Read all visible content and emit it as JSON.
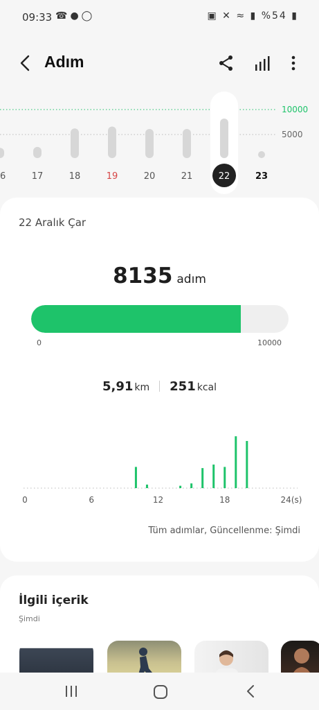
{
  "status_bar": {
    "time": "09:33",
    "left_icons": [
      "whatsapp-icon",
      "notification-icon",
      "shazam-icon"
    ],
    "right_icons": [
      "battery-saver-icon",
      "mute-icon",
      "wifi-icon",
      "signal-icon",
      "battery-icon"
    ],
    "battery": "%54"
  },
  "app_bar": {
    "title": "Adım",
    "actions": [
      "share-icon",
      "bar-chart-icon",
      "more-vertical-icon"
    ]
  },
  "week_chart": {
    "goal_label": "10000",
    "mid_label": "5000",
    "days": [
      {
        "label": "16",
        "steps": 2100,
        "status": "normal"
      },
      {
        "label": "17",
        "steps": 2300,
        "status": "normal"
      },
      {
        "label": "18",
        "steps": 6100,
        "status": "normal"
      },
      {
        "label": "19",
        "steps": 6500,
        "status": "sunday"
      },
      {
        "label": "20",
        "steps": 6000,
        "status": "normal"
      },
      {
        "label": "21",
        "steps": 6000,
        "status": "normal"
      },
      {
        "label": "22",
        "steps": 8135,
        "status": "selected"
      },
      {
        "label": "23",
        "steps": 0,
        "status": "future"
      }
    ],
    "max": 10000,
    "colors": {
      "bar": "#d7d7d7",
      "goal_line": "#1ec36a",
      "sunday": "#d64545",
      "selected_bg": "#222222"
    }
  },
  "day_summary": {
    "date": "22 Aralık Çar",
    "steps": "8135",
    "steps_unit": "adım",
    "progress": {
      "value": 8135,
      "goal": 10000,
      "min_label": "0",
      "max_label": "10000"
    },
    "distance": "5,91",
    "distance_unit": "km",
    "calories": "251",
    "calories_unit": "kcal",
    "accent_color": "#1ec36a"
  },
  "chart_data": {
    "type": "bar",
    "x_tick_labels": [
      "0",
      "6",
      "12",
      "18",
      "24(s)"
    ],
    "x": [
      10,
      11,
      14,
      15,
      16,
      17,
      18,
      19,
      20
    ],
    "values": [
      900,
      150,
      100,
      200,
      850,
      1000,
      900,
      2200,
      2000
    ],
    "baseline_dots": true,
    "xlim": [
      0,
      24
    ],
    "ylim": [
      0,
      2500
    ],
    "grid": false
  },
  "update_note": "Tüm adımlar, Güncellenme: Şimdi",
  "related": {
    "title": "İlgili içerik",
    "subtitle": "Şimdi",
    "thumbnails": [
      "couch-image",
      "runner-image",
      "woman-stretching-image",
      "athlete-image"
    ]
  },
  "nav_bar": {
    "buttons": [
      "recents-icon",
      "home-icon",
      "back-icon"
    ]
  }
}
